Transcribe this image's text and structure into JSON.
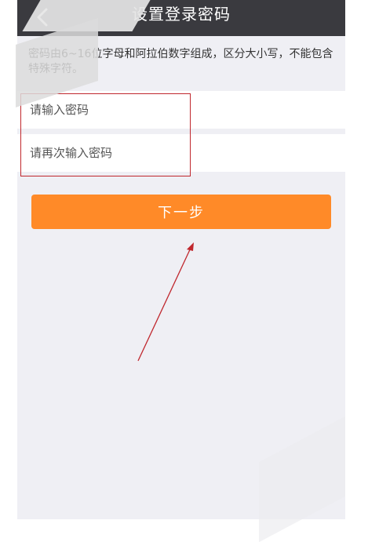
{
  "header": {
    "title": "设置登录密码",
    "back_icon": "chevron-left-icon"
  },
  "hint_text": "密码由6~16位字母和阿拉伯数字组成，区分大小写，不能包含特殊字符。",
  "form": {
    "password_placeholder": "请输入密码",
    "confirm_placeholder": "请再次输入密码"
  },
  "next_button_label": "下一步",
  "colors": {
    "titlebar": "#3a3a3f",
    "accent": "#ff8a28",
    "annotation": "#c0272d",
    "background": "#efeff4"
  }
}
